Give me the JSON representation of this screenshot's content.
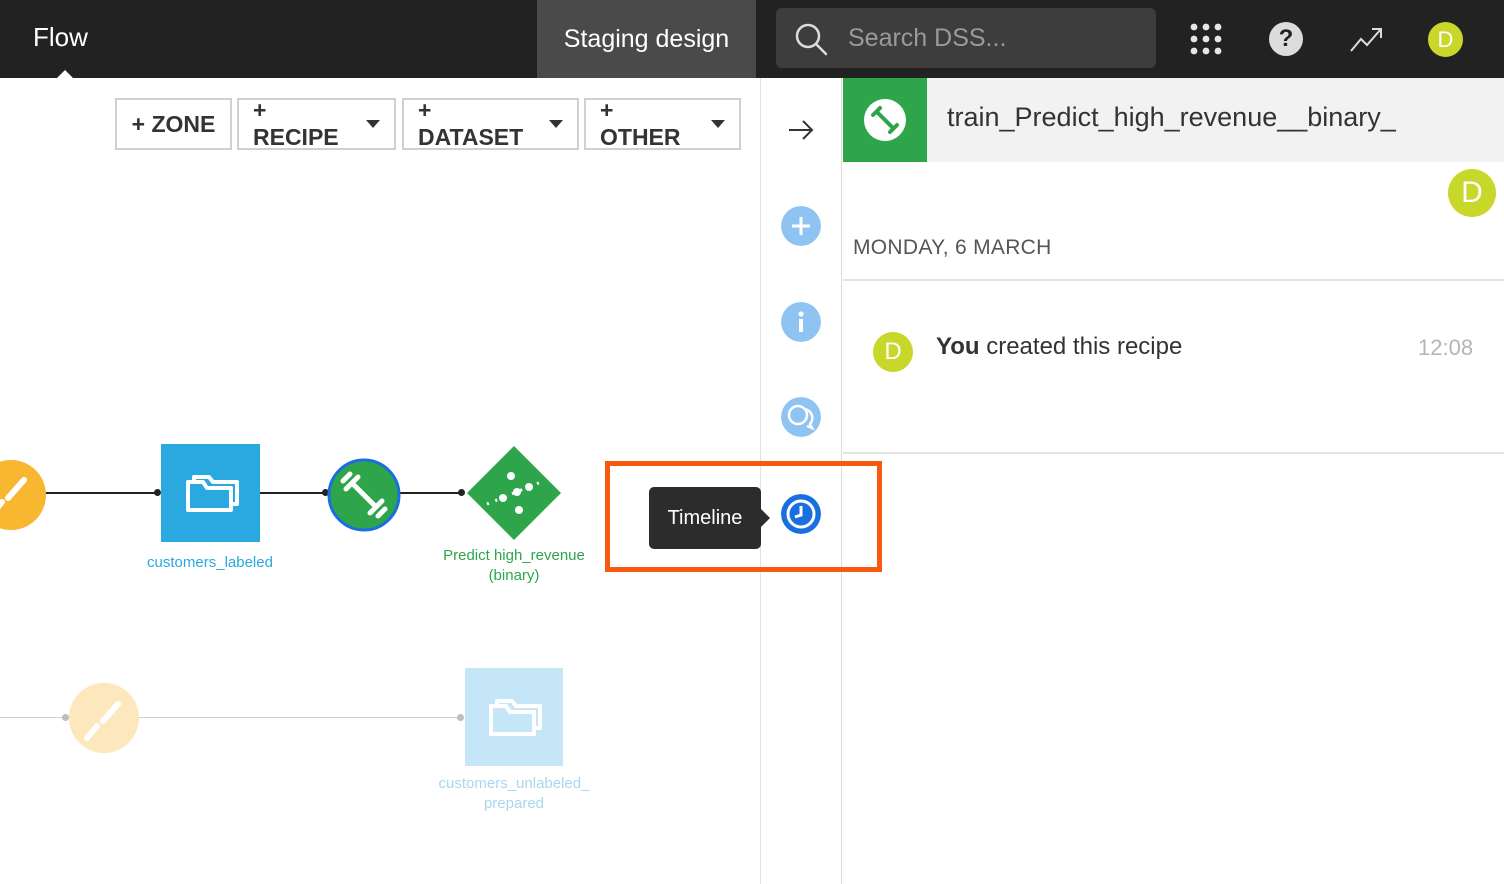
{
  "topbar": {
    "nav_label": "Flow",
    "project_tab": "Staging design",
    "search_placeholder": "Search DSS...",
    "icons": [
      "search-icon",
      "apps-grid-icon",
      "help-icon",
      "trend-icon"
    ],
    "avatar_initial": "D"
  },
  "toolbar": {
    "zone": "+ ZONE",
    "recipe": "+ RECIPE",
    "dataset": "+ DATASET",
    "other": "+ OTHER"
  },
  "flow": {
    "nodes": {
      "dataset_labeled": "customers_labeled",
      "train_output_line1": "Predict high_revenue",
      "train_output_line2": "(binary)",
      "dataset_unlabeled_line1": "customers_unlabeled_",
      "dataset_unlabeled_line2": "prepared"
    }
  },
  "rail": {
    "icons": [
      "arrow-right-icon",
      "plus-icon",
      "info-icon",
      "discussions-icon",
      "timeline-icon"
    ],
    "tooltip": "Timeline"
  },
  "panel": {
    "title": "train_Predict_high_revenue__binary_",
    "avatar_initial": "D",
    "date": "MONDAY, 6 MARCH",
    "entry": {
      "actor": "You",
      "action": " created this recipe",
      "time": "12:08",
      "avatar_initial": "D"
    }
  },
  "colors": {
    "topbar": "#222222",
    "accent_green": "#2ea54a",
    "dataset_blue": "#2aa9e0",
    "prep_yellow": "#f7b731",
    "avatar_yellow": "#c9d62a",
    "highlight_orange": "#f55a0f",
    "timeline_blue": "#1a6fe0",
    "rail_icon_blue": "#8fc3f2"
  }
}
